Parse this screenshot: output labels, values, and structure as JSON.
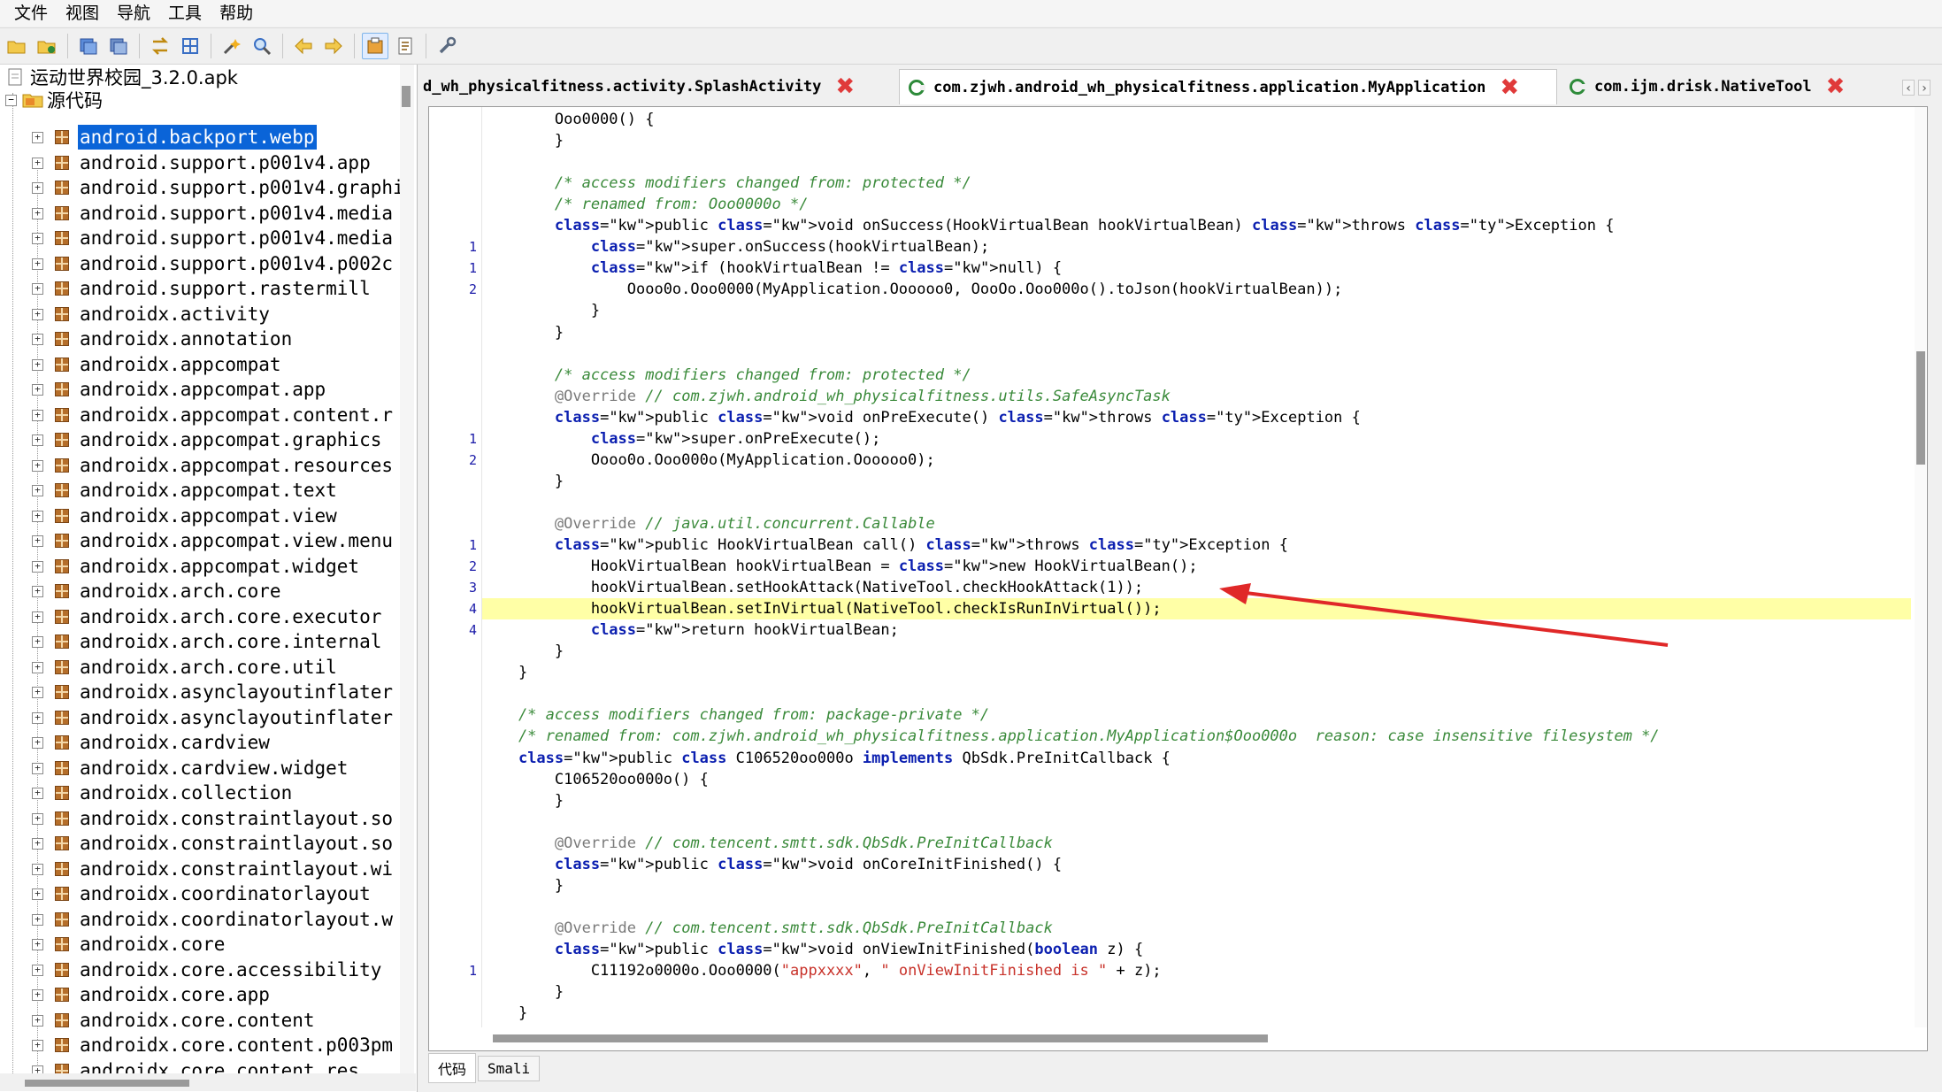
{
  "menu": [
    "文件",
    "视图",
    "导航",
    "工具",
    "帮助"
  ],
  "toolbar_icons": [
    "open-folder-icon",
    "add-file-icon",
    "save-icon",
    "save-all-icon",
    "sync-icon",
    "grid-icon",
    "magic-wand-icon",
    "search-icon",
    "back-arrow-icon",
    "forward-arrow-icon",
    "decompile-icon",
    "log-icon",
    "settings-wrench-icon"
  ],
  "tree": {
    "root": "运动世界校园_3.2.0.apk",
    "source_node": "源代码",
    "packages": [
      "android.backport.webp",
      "android.support.p001v4.app",
      "android.support.p001v4.graphi",
      "android.support.p001v4.media",
      "android.support.p001v4.media",
      "android.support.p001v4.p002c",
      "android.support.rastermill",
      "androidx.activity",
      "androidx.annotation",
      "androidx.appcompat",
      "androidx.appcompat.app",
      "androidx.appcompat.content.r",
      "androidx.appcompat.graphics",
      "androidx.appcompat.resources",
      "androidx.appcompat.text",
      "androidx.appcompat.view",
      "androidx.appcompat.view.menu",
      "androidx.appcompat.widget",
      "androidx.arch.core",
      "androidx.arch.core.executor",
      "androidx.arch.core.internal",
      "androidx.arch.core.util",
      "androidx.asynclayoutinflater",
      "androidx.asynclayoutinflater",
      "androidx.cardview",
      "androidx.cardview.widget",
      "androidx.collection",
      "androidx.constraintlayout.so",
      "androidx.constraintlayout.so",
      "androidx.constraintlayout.wi",
      "androidx.coordinatorlayout",
      "androidx.coordinatorlayout.w",
      "androidx.core",
      "androidx.core.accessibility",
      "androidx.core.app",
      "androidx.core.content",
      "androidx.core.content.p003pm",
      "androidx.core.content.res"
    ]
  },
  "tabs": [
    {
      "label": "d_wh_physicalfitness.activity.SplashActivity",
      "active": false
    },
    {
      "label": "com.zjwh.android_wh_physicalfitness.application.MyApplication",
      "active": true
    },
    {
      "label": "com.ijm.drisk.NativeTool",
      "active": false
    }
  ],
  "code_lines": [
    {
      "n": "",
      "hl": false,
      "t": "        Ooo0000() {"
    },
    {
      "n": "",
      "hl": false,
      "t": "        }"
    },
    {
      "n": "",
      "hl": false,
      "t": ""
    },
    {
      "n": "",
      "hl": false,
      "t": "        /* access modifiers changed from: protected */"
    },
    {
      "n": "",
      "hl": false,
      "t": "        /* renamed from: Ooo0000o */"
    },
    {
      "n": "",
      "hl": false,
      "t": "        public void onSuccess(HookVirtualBean hookVirtualBean) throws Exception {"
    },
    {
      "n": "1",
      "hl": false,
      "t": "            super.onSuccess(hookVirtualBean);"
    },
    {
      "n": "1",
      "hl": false,
      "t": "            if (hookVirtualBean != null) {"
    },
    {
      "n": "2",
      "hl": false,
      "t": "                Oooo0o.Ooo0000(MyApplication.Oooooo0, OooOo.Ooo000o().toJson(hookVirtualBean));"
    },
    {
      "n": "",
      "hl": false,
      "t": "            }"
    },
    {
      "n": "",
      "hl": false,
      "t": "        }"
    },
    {
      "n": "",
      "hl": false,
      "t": ""
    },
    {
      "n": "",
      "hl": false,
      "t": "        /* access modifiers changed from: protected */"
    },
    {
      "n": "",
      "hl": false,
      "t": "        @Override // com.zjwh.android_wh_physicalfitness.utils.SafeAsyncTask"
    },
    {
      "n": "",
      "hl": false,
      "t": "        public void onPreExecute() throws Exception {"
    },
    {
      "n": "1",
      "hl": false,
      "t": "            super.onPreExecute();"
    },
    {
      "n": "2",
      "hl": false,
      "t": "            Oooo0o.Ooo000o(MyApplication.Oooooo0);"
    },
    {
      "n": "",
      "hl": false,
      "t": "        }"
    },
    {
      "n": "",
      "hl": false,
      "t": ""
    },
    {
      "n": "",
      "hl": false,
      "t": "        @Override // java.util.concurrent.Callable"
    },
    {
      "n": "1",
      "hl": false,
      "t": "        public HookVirtualBean call() throws Exception {"
    },
    {
      "n": "2",
      "hl": false,
      "t": "            HookVirtualBean hookVirtualBean = new HookVirtualBean();"
    },
    {
      "n": "3",
      "hl": false,
      "t": "            hookVirtualBean.setHookAttack(NativeTool.checkHookAttack(1));"
    },
    {
      "n": "4",
      "hl": true,
      "t": "            hookVirtualBean.setInVirtual(NativeTool.checkIsRunInVirtual());"
    },
    {
      "n": "4",
      "hl": false,
      "t": "            return hookVirtualBean;"
    },
    {
      "n": "",
      "hl": false,
      "t": "        }"
    },
    {
      "n": "",
      "hl": false,
      "t": "    }"
    },
    {
      "n": "",
      "hl": false,
      "t": ""
    },
    {
      "n": "",
      "hl": false,
      "t": "    /* access modifiers changed from: package-private */"
    },
    {
      "n": "",
      "hl": false,
      "t": "    /* renamed from: com.zjwh.android_wh_physicalfitness.application.MyApplication$Ooo000o  reason: case insensitive filesystem */"
    },
    {
      "n": "",
      "hl": false,
      "t": "    public class C106520oo000o implements QbSdk.PreInitCallback {"
    },
    {
      "n": "",
      "hl": false,
      "t": "        C106520oo000o() {"
    },
    {
      "n": "",
      "hl": false,
      "t": "        }"
    },
    {
      "n": "",
      "hl": false,
      "t": ""
    },
    {
      "n": "",
      "hl": false,
      "t": "        @Override // com.tencent.smtt.sdk.QbSdk.PreInitCallback"
    },
    {
      "n": "",
      "hl": false,
      "t": "        public void onCoreInitFinished() {"
    },
    {
      "n": "",
      "hl": false,
      "t": "        }"
    },
    {
      "n": "",
      "hl": false,
      "t": ""
    },
    {
      "n": "",
      "hl": false,
      "t": "        @Override // com.tencent.smtt.sdk.QbSdk.PreInitCallback"
    },
    {
      "n": "",
      "hl": false,
      "t": "        public void onViewInitFinished(boolean z) {"
    },
    {
      "n": "1",
      "hl": false,
      "t": "            C11192o0000o.Ooo0000(\"appxxxx\", \" onViewInitFinished is \" + z);"
    },
    {
      "n": "",
      "hl": false,
      "t": "        }"
    },
    {
      "n": "",
      "hl": false,
      "t": "    }"
    }
  ],
  "bottom_tabs": [
    "代码",
    "Smali"
  ],
  "colors": {
    "keyword": "#0b1fb0",
    "comment": "#3a8a3a",
    "string": "#c8322a",
    "highlight": "#ffffa6",
    "selection": "#0a64d8",
    "arrow": "#e02828"
  }
}
